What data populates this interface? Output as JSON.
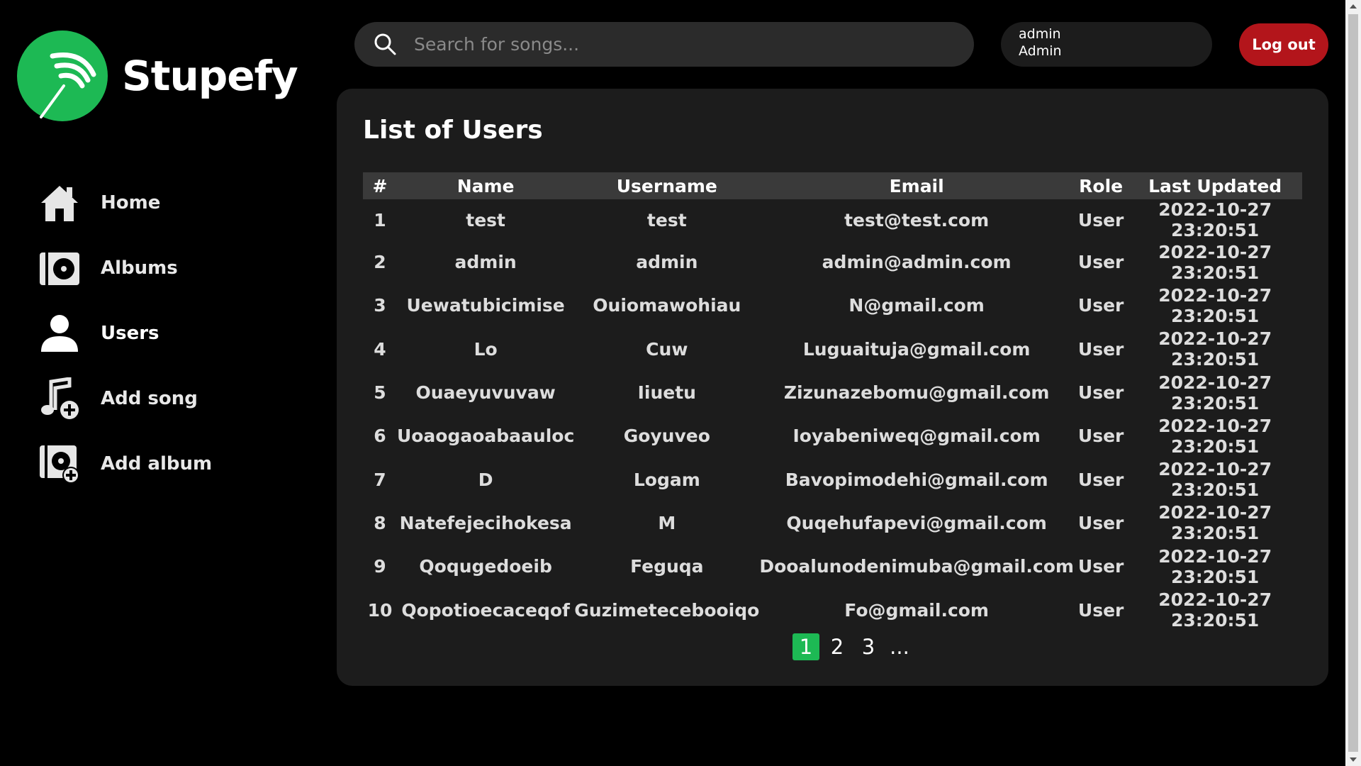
{
  "app": {
    "name": "Stupefy",
    "brand_color": "#1db954",
    "danger_color": "#b3151b"
  },
  "sidebar": {
    "items": [
      {
        "label": "Home",
        "icon": "home-icon"
      },
      {
        "label": "Albums",
        "icon": "album-icon"
      },
      {
        "label": "Users",
        "icon": "user-icon",
        "active": true
      },
      {
        "label": "Add song",
        "icon": "add-song-icon"
      },
      {
        "label": "Add album",
        "icon": "add-album-icon"
      }
    ]
  },
  "header": {
    "search_placeholder": "Search for songs...",
    "user": {
      "username": "admin",
      "role": "Admin"
    },
    "logout_label": "Log out"
  },
  "main": {
    "title": "List of Users",
    "columns": [
      "#",
      "Name",
      "Username",
      "Email",
      "Role",
      "Last Updated"
    ],
    "rows": [
      [
        "1",
        "test",
        "test",
        "test@test.com",
        "User",
        "2022-10-27 23:20:51"
      ],
      [
        "2",
        "admin",
        "admin",
        "admin@admin.com",
        "User",
        "2022-10-27 23:20:51"
      ],
      [
        "3",
        "Uewatubicimise",
        "Ouiomawohiau",
        "N@gmail.com",
        "User",
        "2022-10-27 23:20:51"
      ],
      [
        "4",
        "Lo",
        "Cuw",
        "Luguaituja@gmail.com",
        "User",
        "2022-10-27 23:20:51"
      ],
      [
        "5",
        "Ouaeyuvuvaw",
        "Iiuetu",
        "Zizunazebomu@gmail.com",
        "User",
        "2022-10-27 23:20:51"
      ],
      [
        "6",
        "Uoaogaoabaauloc",
        "Goyuveo",
        "Ioyabeniweq@gmail.com",
        "User",
        "2022-10-27 23:20:51"
      ],
      [
        "7",
        "D",
        "Logam",
        "Bavopimodehi@gmail.com",
        "User",
        "2022-10-27 23:20:51"
      ],
      [
        "8",
        "Natefejecihokesa",
        "M",
        "Quqehufapevi@gmail.com",
        "User",
        "2022-10-27 23:20:51"
      ],
      [
        "9",
        "Qoqugedoeib",
        "Feguqa",
        "Dooalunodenimuba@gmail.com",
        "User",
        "2022-10-27 23:20:51"
      ],
      [
        "10",
        "Qopotioecaceqof",
        "Guzimetecebooiqo",
        "Fo@gmail.com",
        "User",
        "2022-10-27 23:20:51"
      ]
    ],
    "pagination": {
      "pages": [
        "1",
        "2",
        "3",
        "..."
      ],
      "current": "1"
    }
  }
}
